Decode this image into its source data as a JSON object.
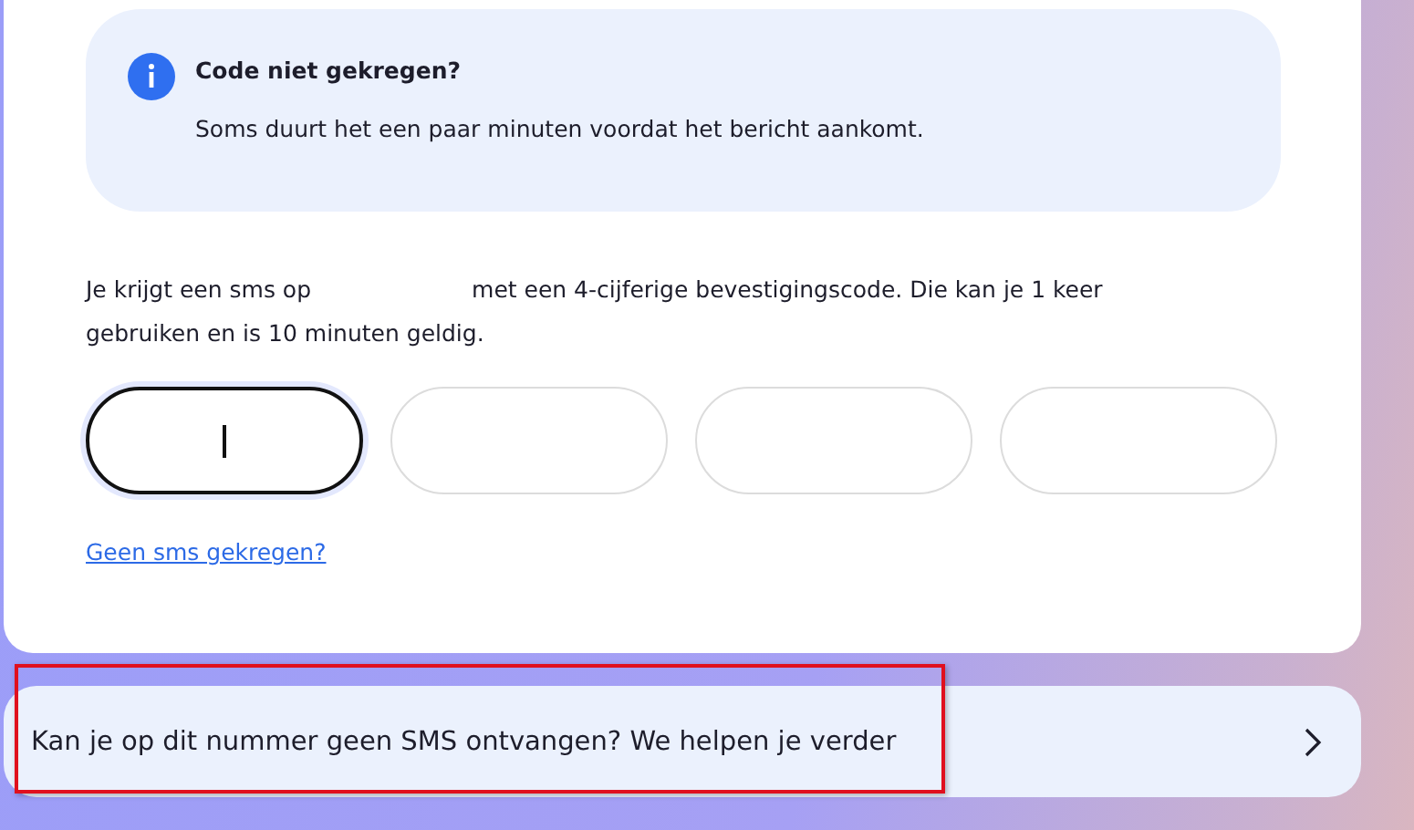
{
  "info": {
    "title": "Code niet gekregen?",
    "body": "Soms duurt het een paar minuten voordat het bericht aankomt."
  },
  "instructions": {
    "before": "Je krijgt een sms op",
    "after": "met een 4-cijferige bevestigingscode. Die kan je 1 keer gebruiken en is 10 minuten geldig."
  },
  "code_fields": [
    {
      "focused": true
    },
    {
      "focused": false
    },
    {
      "focused": false
    },
    {
      "focused": false
    }
  ],
  "resend_link": "Geen sms gekregen?",
  "help": {
    "label": "Kan je op dit nummer geen SMS ontvangen? We helpen je verder",
    "highlighted": true
  }
}
